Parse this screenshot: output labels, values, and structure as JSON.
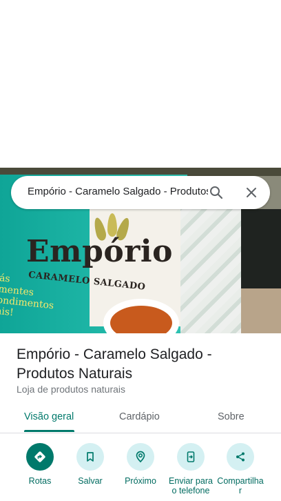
{
  "search": {
    "query": "Empório - Caramelo Salgado - Produtos Naturais"
  },
  "hero": {
    "logo_title": "Empório",
    "logo_subtitle": "CARAMELO SALGADO",
    "side_text": [
      "ás",
      "mentes",
      "ondimentos",
      "ais!"
    ]
  },
  "place": {
    "name": "Empório - Caramelo Salgado - Produtos Naturais",
    "category": "Loja de produtos naturais"
  },
  "tabs": [
    {
      "label": "Visão geral",
      "active": true
    },
    {
      "label": "Cardápio",
      "active": false
    },
    {
      "label": "Sobre",
      "active": false
    }
  ],
  "actions": [
    {
      "label": "Rotas",
      "icon": "directions-icon"
    },
    {
      "label": "Salvar",
      "icon": "bookmark-icon"
    },
    {
      "label": "Próximo",
      "icon": "nearby-icon"
    },
    {
      "label": "Enviar para o telefone",
      "icon": "send-to-phone-icon"
    },
    {
      "label": "Compartilhar",
      "icon": "share-icon"
    }
  ],
  "colors": {
    "accent": "#00796b",
    "action_bg": "#d4f0f2",
    "banner": "#1fb3a3"
  }
}
